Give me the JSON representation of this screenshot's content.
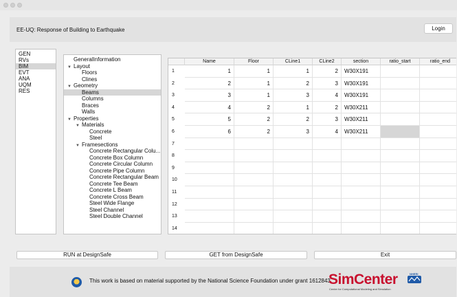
{
  "app": {
    "title": "EE-UQ: Response of Building to Earthquake",
    "login_label": "Login"
  },
  "sidebar": {
    "items": [
      "GEN",
      "RVs",
      "BIM",
      "EVT",
      "ANA",
      "UQM",
      "RES"
    ],
    "selected": "BIM"
  },
  "tree": {
    "items": [
      {
        "label": "GeneralInformation",
        "level": 0,
        "arrow": false
      },
      {
        "label": "Layout",
        "level": 0,
        "arrow": true
      },
      {
        "label": "Floors",
        "level": 1,
        "arrow": false
      },
      {
        "label": "Clines",
        "level": 1,
        "arrow": false
      },
      {
        "label": "Geometry",
        "level": 0,
        "arrow": true
      },
      {
        "label": "Beams",
        "level": 1,
        "arrow": false,
        "selected": true
      },
      {
        "label": "Columns",
        "level": 1,
        "arrow": false
      },
      {
        "label": "Braces",
        "level": 1,
        "arrow": false
      },
      {
        "label": "Walls",
        "level": 1,
        "arrow": false
      },
      {
        "label": "Properties",
        "level": 0,
        "arrow": true
      },
      {
        "label": "Materials",
        "level": 1,
        "arrow": true
      },
      {
        "label": "Concrete",
        "level": 2,
        "arrow": false
      },
      {
        "label": "Steel",
        "level": 2,
        "arrow": false
      },
      {
        "label": "Framesections",
        "level": 1,
        "arrow": true
      },
      {
        "label": "Concrete Rectangular Colu...",
        "level": 2,
        "arrow": false
      },
      {
        "label": "Concrete Box Column",
        "level": 2,
        "arrow": false
      },
      {
        "label": "Concrete Circular Column",
        "level": 2,
        "arrow": false
      },
      {
        "label": "Concrete Pipe Column",
        "level": 2,
        "arrow": false
      },
      {
        "label": "Concrete Rectangular Beam",
        "level": 2,
        "arrow": false
      },
      {
        "label": "Concrete Tee Beam",
        "level": 2,
        "arrow": false
      },
      {
        "label": "Concrete L Beam",
        "level": 2,
        "arrow": false
      },
      {
        "label": "Concrete Cross Beam",
        "level": 2,
        "arrow": false
      },
      {
        "label": "Steel Wide Flange",
        "level": 2,
        "arrow": false
      },
      {
        "label": "Steel Channel",
        "level": 2,
        "arrow": false
      },
      {
        "label": "Steel Double Channel",
        "level": 2,
        "arrow": false
      }
    ]
  },
  "table": {
    "columns": [
      "Name",
      "Floor",
      "CLine1",
      "CLine2",
      "section",
      "ratio_start",
      "ratio_end"
    ],
    "rows": [
      [
        "1",
        "1",
        "1",
        "2",
        "W30X191",
        "",
        ""
      ],
      [
        "2",
        "1",
        "2",
        "3",
        "W30X191",
        "",
        ""
      ],
      [
        "3",
        "1",
        "3",
        "4",
        "W30X191",
        "",
        ""
      ],
      [
        "4",
        "2",
        "1",
        "2",
        "W30X211",
        "",
        ""
      ],
      [
        "5",
        "2",
        "2",
        "3",
        "W30X211",
        "",
        ""
      ],
      [
        "6",
        "2",
        "3",
        "4",
        "W30X211",
        "",
        ""
      ],
      [
        "",
        "",
        "",
        "",
        "",
        "",
        ""
      ],
      [
        "",
        "",
        "",
        "",
        "",
        "",
        ""
      ],
      [
        "",
        "",
        "",
        "",
        "",
        "",
        ""
      ],
      [
        "",
        "",
        "",
        "",
        "",
        "",
        ""
      ],
      [
        "",
        "",
        "",
        "",
        "",
        "",
        ""
      ],
      [
        "",
        "",
        "",
        "",
        "",
        "",
        ""
      ],
      [
        "",
        "",
        "",
        "",
        "",
        "",
        ""
      ],
      [
        "",
        "",
        "",
        "",
        "",
        "",
        ""
      ]
    ],
    "row_numbers": [
      "1",
      "2",
      "3",
      "4",
      "5",
      "6",
      "7",
      "8",
      "9",
      "10",
      "11",
      "12",
      "13",
      "14"
    ],
    "selected_cell": {
      "row": 6,
      "col": 5
    }
  },
  "buttons": {
    "run": "RUN at DesignSafe",
    "get": "GET from DesignSafe",
    "exit": "Exit"
  },
  "footer": {
    "text": "This work is based on material supported by the National Science Foundation under grant 1612843",
    "brand": "SimCenter",
    "brand_sub": "Center for Computational Modeling and Simulation",
    "badge": "NHERI"
  },
  "colors": {
    "brand": "#c8102e",
    "selection": "#d6d6d6",
    "nsf_blue": "#1f5aa8"
  }
}
